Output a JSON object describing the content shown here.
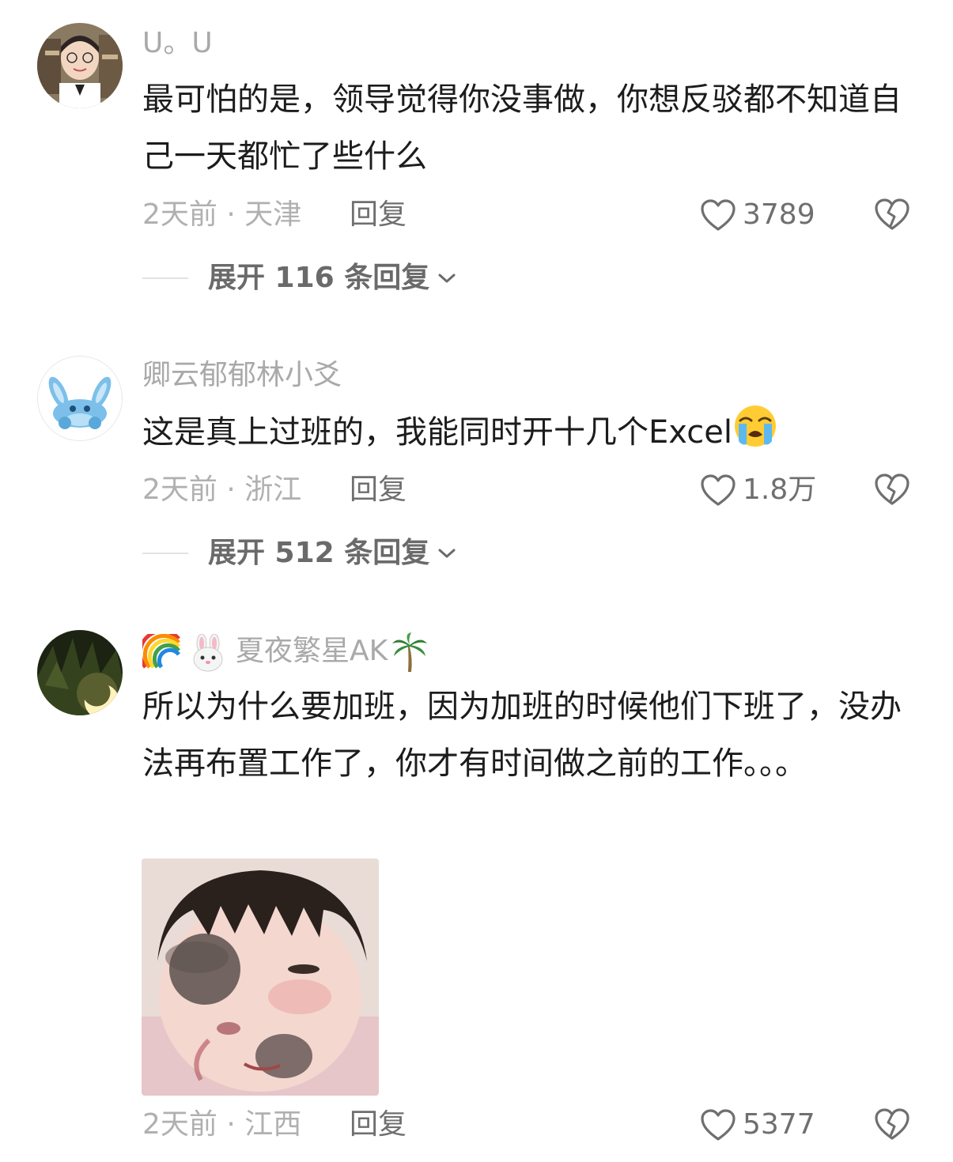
{
  "comments": [
    {
      "username": "U。U",
      "text": "最可怕的是，领导觉得你没事做，你想反驳都不知道自己一天都忙了些什么",
      "meta": "2天前 · 天津",
      "reply_label": "回复",
      "likes": "3789",
      "expand_label": "展开 116 条回复",
      "avatar_icon": "user-avatar-photo"
    },
    {
      "username": "卿云郁郁林小爻",
      "text": "这是真上过班的，我能同时开十几个Excel",
      "text_emoji": "loudly-crying-face-emoji",
      "meta": "2天前 · 浙江",
      "reply_label": "回复",
      "likes": "1.8万",
      "expand_label": "展开 512 条回复",
      "avatar_icon": "stitch-avatar"
    },
    {
      "username_prefix_emojis": [
        "rainbow-emoji",
        "rabbit-face-emoji"
      ],
      "username": "夏夜繁星AK",
      "username_suffix_emoji": "palm-tree-emoji",
      "text": "所以为什么要加班，因为加班的时候他们下班了，没办法再布置工作了，你才有时间做之前的工作。。。",
      "sticker": "crying-baby-sticker",
      "meta": "2天前 · 江西",
      "reply_label": "回复",
      "likes": "5377",
      "avatar_icon": "moon-avatar"
    }
  ],
  "colors": {
    "background": "#ffffff",
    "username": "#a9a9a9",
    "body_text": "#1c1c1c",
    "meta_text": "#b0b0b0",
    "action_text": "#6f6f6f"
  }
}
